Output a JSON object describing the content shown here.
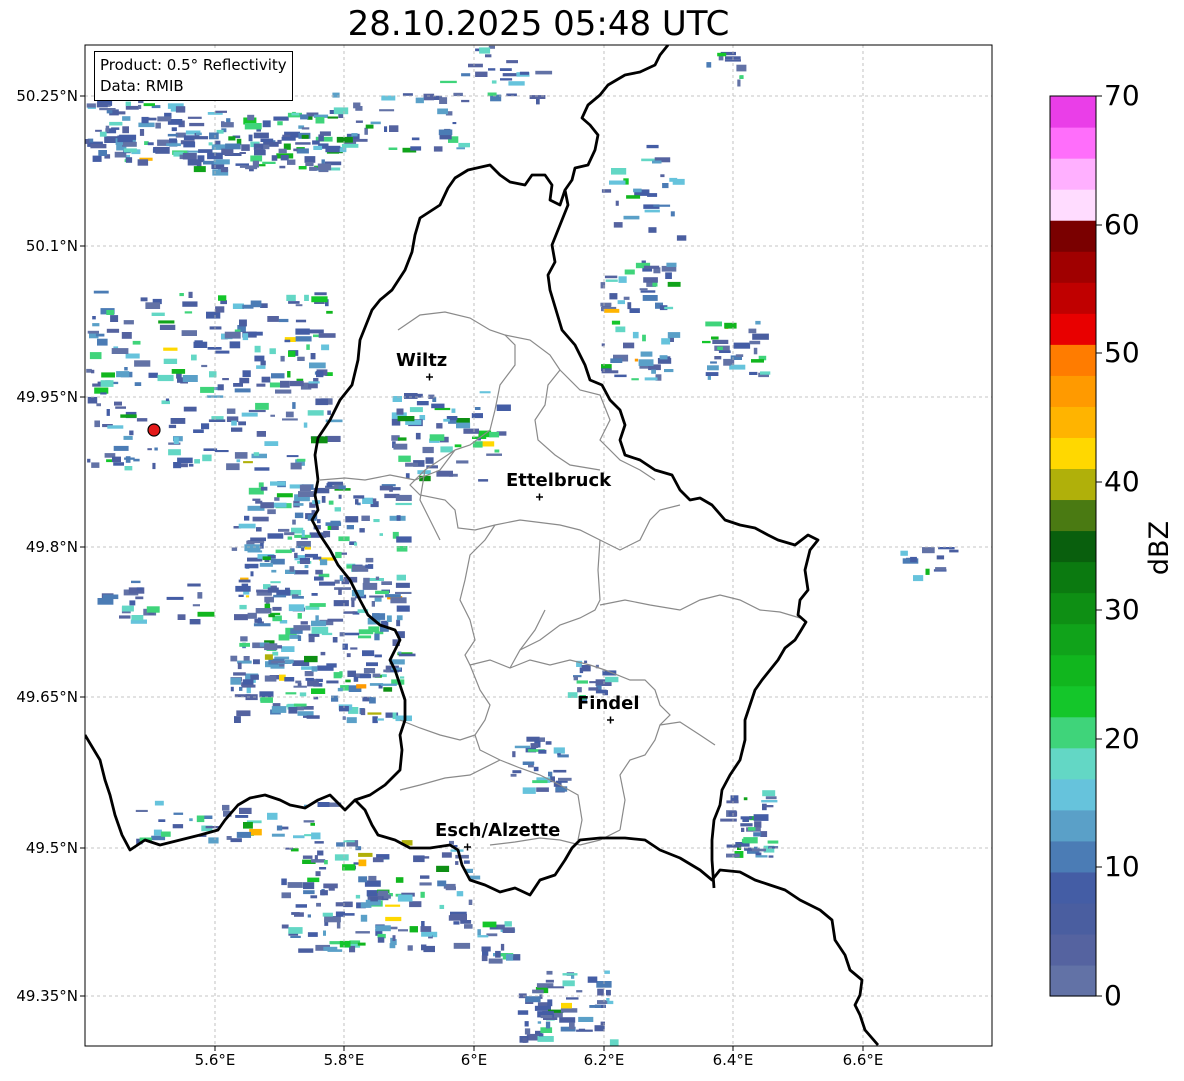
{
  "title": "28.10.2025 05:48 UTC",
  "info": {
    "product": "Product: 0.5° Reflectivity",
    "data": "Data: RMIB"
  },
  "map": {
    "lon_range": [
      5.4,
      6.8
    ],
    "lat_range": [
      49.3,
      50.3
    ],
    "lat_ticks": [
      "50.25°N",
      "50.1°N",
      "49.95°N",
      "49.8°N",
      "49.65°N",
      "49.5°N",
      "49.35°N"
    ],
    "lon_ticks": [
      "5.6°E",
      "5.8°E",
      "6°E",
      "6.2°E",
      "6.4°E",
      "6.6°E"
    ],
    "grid": true,
    "radar_site": "radar-site-marker",
    "cities": [
      {
        "name": "Wiltz",
        "lon": 5.93,
        "lat": 49.97
      },
      {
        "name": "Ettelbruck",
        "lon": 6.1,
        "lat": 49.85
      },
      {
        "name": "Findel",
        "lon": 6.21,
        "lat": 49.63
      },
      {
        "name": "Esch/Alzette",
        "lon": 5.99,
        "lat": 49.5
      }
    ]
  },
  "colorbar": {
    "label": "dBZ",
    "ticks": [
      "70",
      "60",
      "50",
      "40",
      "30",
      "20",
      "10",
      "0"
    ],
    "range": [
      0,
      70
    ],
    "colors": [
      "#6272a6",
      "#5563a0",
      "#4a5ea0",
      "#445da5",
      "#4b7cb5",
      "#5aa0c8",
      "#66c3dc",
      "#63d7c5",
      "#3fd47a",
      "#14c62a",
      "#11b61e",
      "#10a31a",
      "#0e8f14",
      "#0b7a10",
      "#095f0d",
      "#4a7a12",
      "#b0b00a",
      "#ffd800",
      "#ffb400",
      "#ff9a00",
      "#ff7c00",
      "#e80000",
      "#c00000",
      "#a00000",
      "#7a0000",
      "#ffdcff",
      "#ffb0ff",
      "#ff6efb",
      "#ea3ee8"
    ]
  }
}
